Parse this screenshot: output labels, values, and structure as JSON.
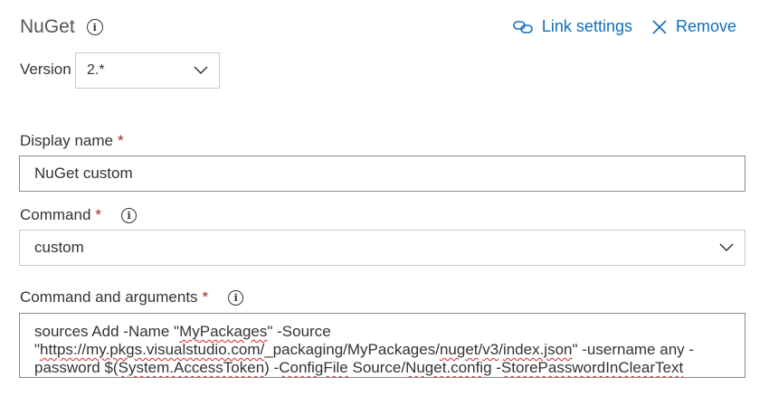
{
  "header": {
    "title": "NuGet",
    "link_settings": "Link settings",
    "remove": "Remove"
  },
  "version": {
    "label": "Version",
    "value": "2.*"
  },
  "display_name": {
    "label": "Display name",
    "required_mark": "*",
    "value": "NuGet custom"
  },
  "command": {
    "label": "Command",
    "required_mark": "*",
    "value": "custom"
  },
  "arguments": {
    "label": "Command and arguments",
    "required_mark": "*",
    "segments": [
      {
        "text": "sources Add -Name \"",
        "spell": false
      },
      {
        "text": "MyPackages",
        "spell": true
      },
      {
        "text": "\" -Source\n\"",
        "spell": false
      },
      {
        "text": "https://my.pkgs.visualstudio.com/",
        "spell": true
      },
      {
        "text": "_packaging/MyPackages/",
        "spell": false
      },
      {
        "text": "nuget",
        "spell": true
      },
      {
        "text": "/",
        "spell": false
      },
      {
        "text": "v3",
        "spell": true
      },
      {
        "text": "/",
        "spell": false
      },
      {
        "text": "index.json",
        "spell": true
      },
      {
        "text": "\" -username any -\npassword $(",
        "spell": false
      },
      {
        "text": "System.AccessToken",
        "spell": true
      },
      {
        "text": ") -",
        "spell": false
      },
      {
        "text": "ConfigFile",
        "spell": true
      },
      {
        "text": " Source/",
        "spell": false
      },
      {
        "text": "Nuget.config",
        "spell": true
      },
      {
        "text": " -",
        "spell": false
      },
      {
        "text": "StorePasswordInClearText",
        "spell": true
      }
    ]
  },
  "icons": {
    "info": "info-icon",
    "link": "link-icon",
    "close": "close-icon",
    "chevron": "chevron-down-icon"
  },
  "colors": {
    "accent": "#106ebe",
    "required": "#a4262c",
    "spellcheck": "#e02020"
  }
}
